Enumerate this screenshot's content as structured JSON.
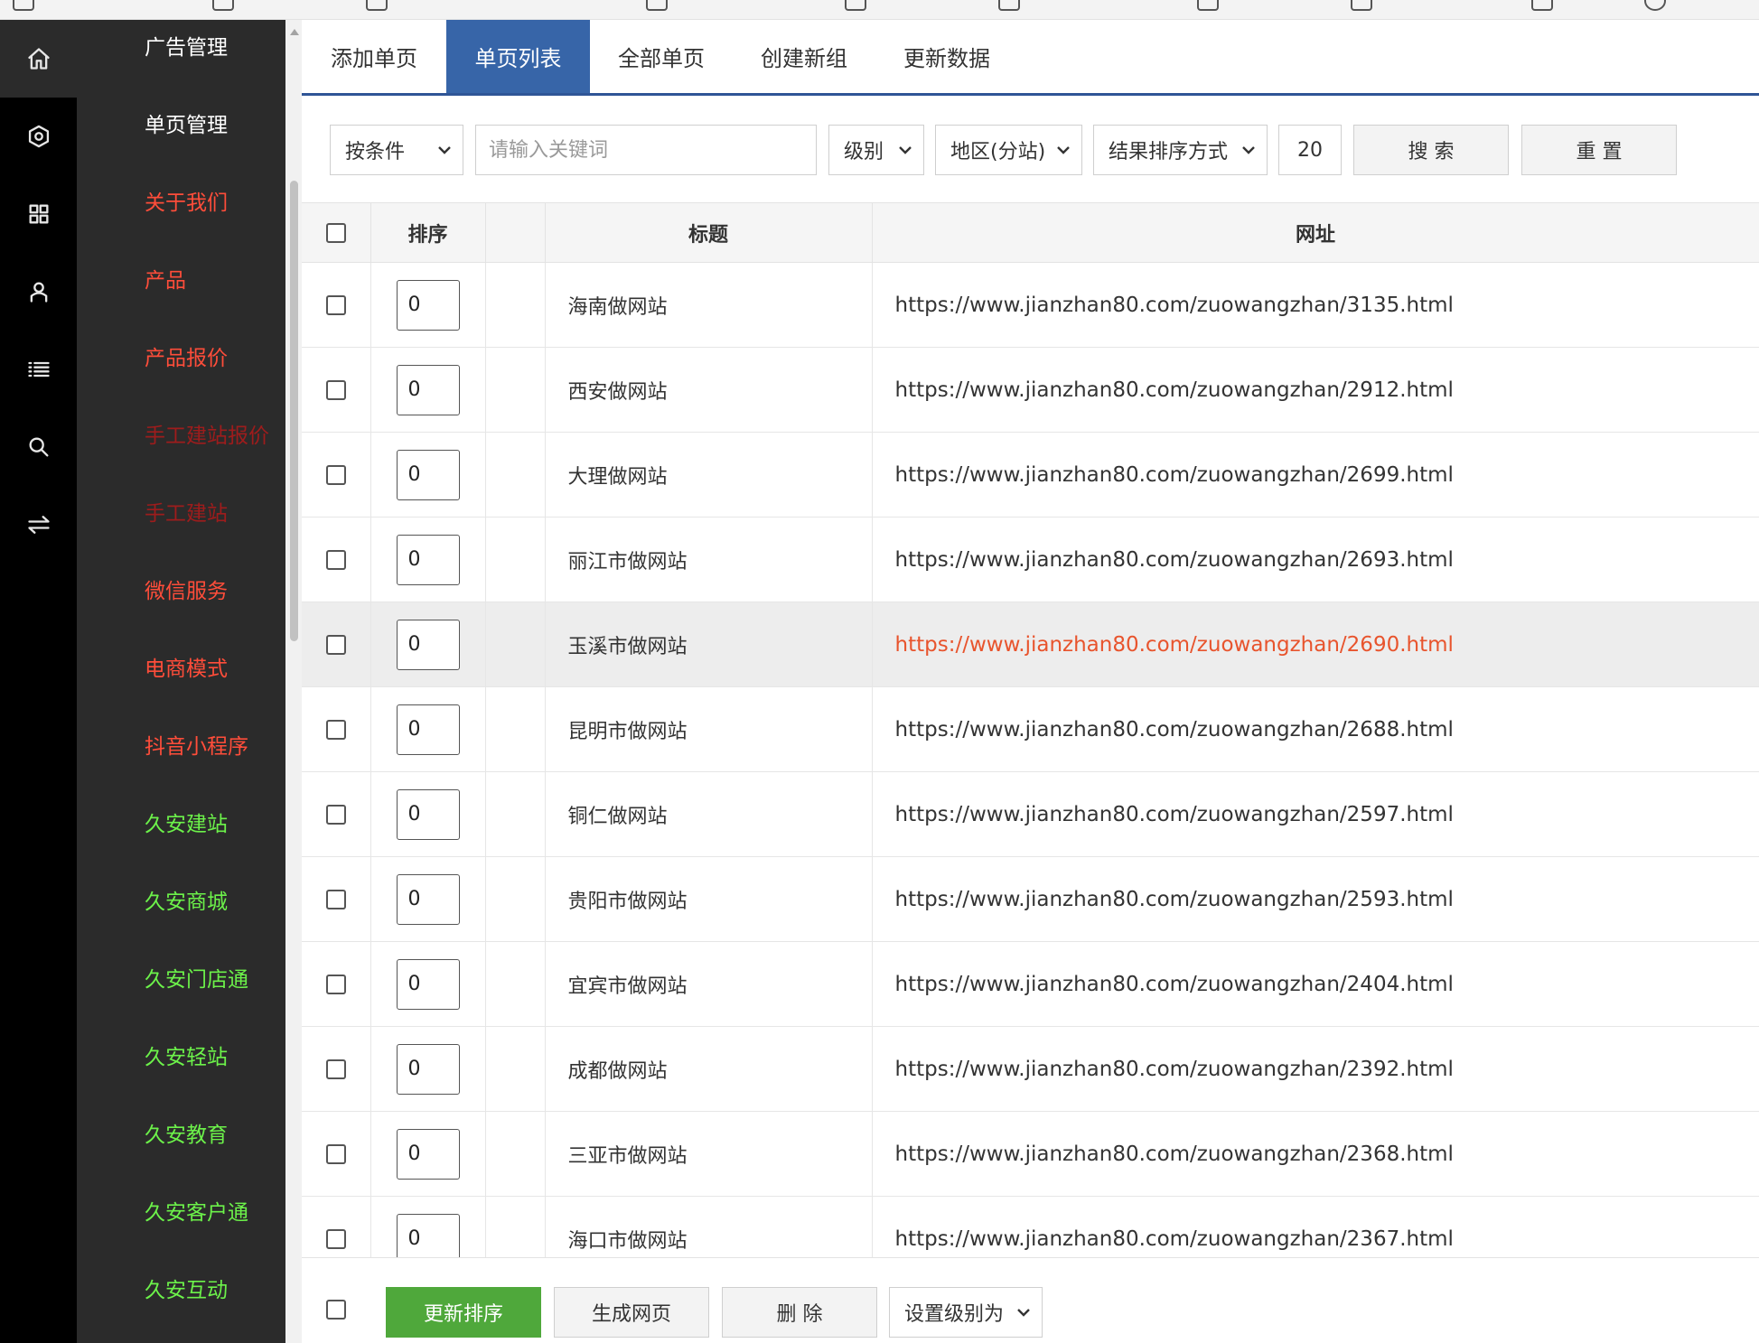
{
  "icon_rail": [
    {
      "icon": "home-icon",
      "active": true
    },
    {
      "icon": "settings-icon",
      "active": false
    },
    {
      "icon": "grid-icon",
      "active": false
    },
    {
      "icon": "user-icon",
      "active": false
    },
    {
      "icon": "list-icon",
      "active": false
    },
    {
      "icon": "search-icon",
      "active": false
    },
    {
      "icon": "swap-icon",
      "active": false
    }
  ],
  "menu": {
    "items": [
      {
        "label": "广告管理",
        "color": "#ffffff"
      },
      {
        "label": "单页管理",
        "color": "#ffffff"
      },
      {
        "label": "关于我们",
        "color": "#ff4d3a"
      },
      {
        "label": "产品",
        "color": "#ff4d3a"
      },
      {
        "label": "产品报价",
        "color": "#ff4d3a"
      },
      {
        "label": "手工建站报价",
        "color": "#9e1c1c"
      },
      {
        "label": "手工建站",
        "color": "#9e1c1c"
      },
      {
        "label": "微信服务",
        "color": "#ff4d3a"
      },
      {
        "label": "电商模式",
        "color": "#ff4d3a"
      },
      {
        "label": "抖音小程序",
        "color": "#ff4d3a"
      },
      {
        "label": "久安建站",
        "color": "#6cf24a"
      },
      {
        "label": "久安商城",
        "color": "#6cf24a"
      },
      {
        "label": "久安门店通",
        "color": "#6cf24a"
      },
      {
        "label": "久安轻站",
        "color": "#6cf24a"
      },
      {
        "label": "久安教育",
        "color": "#6cf24a"
      },
      {
        "label": "久安客户通",
        "color": "#6cf24a"
      },
      {
        "label": "久安互动",
        "color": "#6cf24a"
      }
    ]
  },
  "tabs": [
    {
      "label": "添加单页",
      "active": false
    },
    {
      "label": "单页列表",
      "active": true
    },
    {
      "label": "全部单页",
      "active": false
    },
    {
      "label": "创建新组",
      "active": false
    },
    {
      "label": "更新数据",
      "active": false
    }
  ],
  "filters": {
    "condition": "按条件",
    "keyword_placeholder": "请输入关键词",
    "keyword_value": "",
    "level": "级别",
    "region": "地区(分站)",
    "sort": "结果排序方式",
    "page_size": "20",
    "search_label": "搜 索",
    "reset_label": "重 置"
  },
  "table": {
    "headers": {
      "sort": "排序",
      "title": "标题",
      "url": "网址"
    },
    "rows": [
      {
        "sort": "0",
        "title": "海南做网站",
        "url": "https://www.jianzhan80.com/zuowangzhan/3135.html"
      },
      {
        "sort": "0",
        "title": "西安做网站",
        "url": "https://www.jianzhan80.com/zuowangzhan/2912.html"
      },
      {
        "sort": "0",
        "title": "大理做网站",
        "url": "https://www.jianzhan80.com/zuowangzhan/2699.html"
      },
      {
        "sort": "0",
        "title": "丽江市做网站",
        "url": "https://www.jianzhan80.com/zuowangzhan/2693.html"
      },
      {
        "sort": "0",
        "title": "玉溪市做网站",
        "url": "https://www.jianzhan80.com/zuowangzhan/2690.html",
        "highlight": true
      },
      {
        "sort": "0",
        "title": "昆明市做网站",
        "url": "https://www.jianzhan80.com/zuowangzhan/2688.html"
      },
      {
        "sort": "0",
        "title": "铜仁做网站",
        "url": "https://www.jianzhan80.com/zuowangzhan/2597.html"
      },
      {
        "sort": "0",
        "title": "贵阳市做网站",
        "url": "https://www.jianzhan80.com/zuowangzhan/2593.html"
      },
      {
        "sort": "0",
        "title": "宜宾市做网站",
        "url": "https://www.jianzhan80.com/zuowangzhan/2404.html"
      },
      {
        "sort": "0",
        "title": "成都做网站",
        "url": "https://www.jianzhan80.com/zuowangzhan/2392.html"
      },
      {
        "sort": "0",
        "title": "三亚市做网站",
        "url": "https://www.jianzhan80.com/zuowangzhan/2368.html"
      },
      {
        "sort": "0",
        "title": "海口市做网站",
        "url": "https://www.jianzhan80.com/zuowangzhan/2367.html"
      }
    ]
  },
  "footer": {
    "update_sort": "更新排序",
    "generate": "生成网页",
    "delete": "删 除",
    "set_level": "设置级别为"
  },
  "colors": {
    "tab_active": "#3765a8",
    "primary_green": "#4fa83b",
    "link_hover": "#e8542d"
  }
}
